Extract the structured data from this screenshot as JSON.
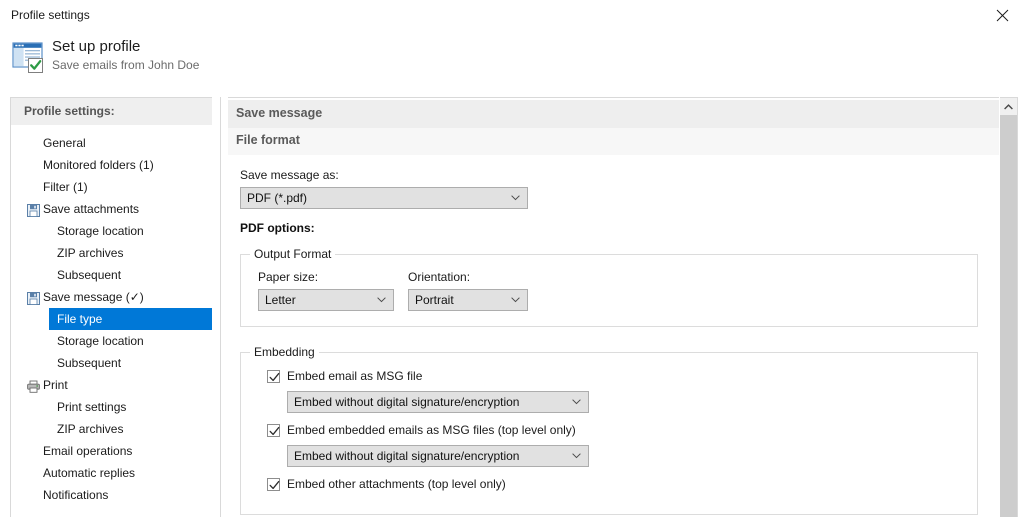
{
  "window": {
    "title": "Profile settings",
    "close_icon": "close-icon"
  },
  "header": {
    "icon": "profile-document-check-icon",
    "title": "Set up profile",
    "subtitle": "Save emails from John Doe"
  },
  "sidebar": {
    "header_label": "Profile settings:",
    "items": [
      {
        "label": "General",
        "level": 0,
        "icon": null,
        "selected": false
      },
      {
        "label": "Monitored folders (1)",
        "level": 0,
        "icon": null,
        "selected": false
      },
      {
        "label": "Filter (1)",
        "level": 0,
        "icon": null,
        "selected": false
      },
      {
        "label": "Save attachments",
        "level": 0,
        "icon": "save-disk-icon",
        "selected": false
      },
      {
        "label": "Storage location",
        "level": 1,
        "icon": null,
        "selected": false
      },
      {
        "label": "ZIP archives",
        "level": 1,
        "icon": null,
        "selected": false
      },
      {
        "label": "Subsequent",
        "level": 1,
        "icon": null,
        "selected": false
      },
      {
        "label": "Save message (✓)",
        "level": 0,
        "icon": "save-disk-icon",
        "selected": false
      },
      {
        "label": "File type",
        "level": 1,
        "icon": null,
        "selected": true
      },
      {
        "label": "Storage location",
        "level": 1,
        "icon": null,
        "selected": false
      },
      {
        "label": "Subsequent",
        "level": 1,
        "icon": null,
        "selected": false
      },
      {
        "label": "Print",
        "level": 0,
        "icon": "printer-icon",
        "selected": false
      },
      {
        "label": "Print settings",
        "level": 1,
        "icon": null,
        "selected": false
      },
      {
        "label": "ZIP archives",
        "level": 1,
        "icon": null,
        "selected": false
      },
      {
        "label": "Email operations",
        "level": 0,
        "icon": null,
        "selected": false
      },
      {
        "label": "Automatic replies",
        "level": 0,
        "icon": null,
        "selected": false
      },
      {
        "label": "Notifications",
        "level": 0,
        "icon": null,
        "selected": false
      }
    ]
  },
  "content": {
    "band_primary": "Save message",
    "band_secondary": "File format",
    "save_message_as_label": "Save message as:",
    "save_message_as_value": "PDF (*.pdf)",
    "pdf_options_label": "PDF options:",
    "output_format": {
      "legend": "Output Format",
      "paper_size_label": "Paper size:",
      "paper_size_value": "Letter",
      "orientation_label": "Orientation:",
      "orientation_value": "Portrait"
    },
    "embedding": {
      "legend": "Embedding",
      "embed_email_label": "Embed email as MSG file",
      "embed_email_checked": true,
      "embed_email_value": "Embed without digital signature/encryption",
      "embed_embedded_label": "Embed embedded emails as MSG files (top level only)",
      "embed_embedded_checked": true,
      "embed_embedded_value": "Embed without digital signature/encryption",
      "embed_other_label": "Embed other attachments (top level only)",
      "embed_other_checked": true
    }
  },
  "scrollbar": {
    "up_arrow_icon": "chevron-up-icon"
  },
  "colors": {
    "selection": "#0078d7",
    "band_primary": "#eeeeee",
    "band_secondary": "#f7f7f7",
    "combo_face": "#e1e1e1",
    "check_green": "#2d9b45"
  }
}
